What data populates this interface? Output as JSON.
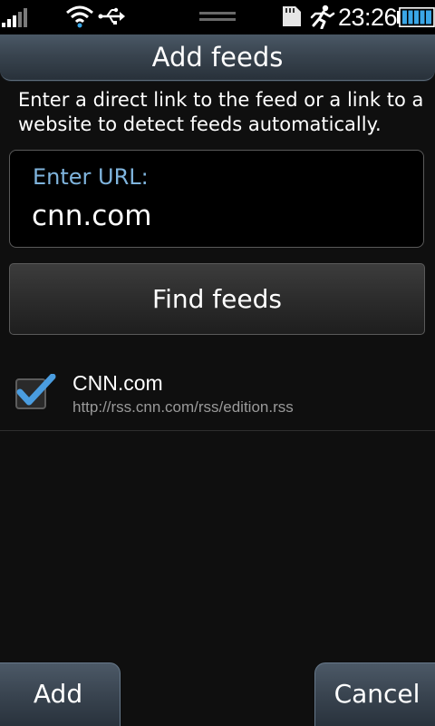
{
  "status_bar": {
    "time": "23:26",
    "icons": [
      "signal-icon",
      "wifi-icon",
      "usb-icon",
      "handle-icon",
      "sd-card-icon",
      "running-man-icon",
      "battery-icon"
    ]
  },
  "title_bar": {
    "title": "Add feeds"
  },
  "instructions": "Enter a direct link to the feed or a link to a website to detect feeds automatically.",
  "url_field": {
    "label": "Enter URL:",
    "value": "cnn.com"
  },
  "find_button": {
    "label": "Find feeds"
  },
  "feeds": [
    {
      "name": "CNN.com",
      "url": "http://rss.cnn.com/rss/edition.rss",
      "checked": true
    }
  ],
  "softkeys": {
    "left_label": "Add",
    "right_label": "Cancel"
  },
  "colors": {
    "accent": "#7fb4dd",
    "checkmark": "#4a9de0",
    "title_bar": "#39444f",
    "battery": "#3aa6e6"
  }
}
